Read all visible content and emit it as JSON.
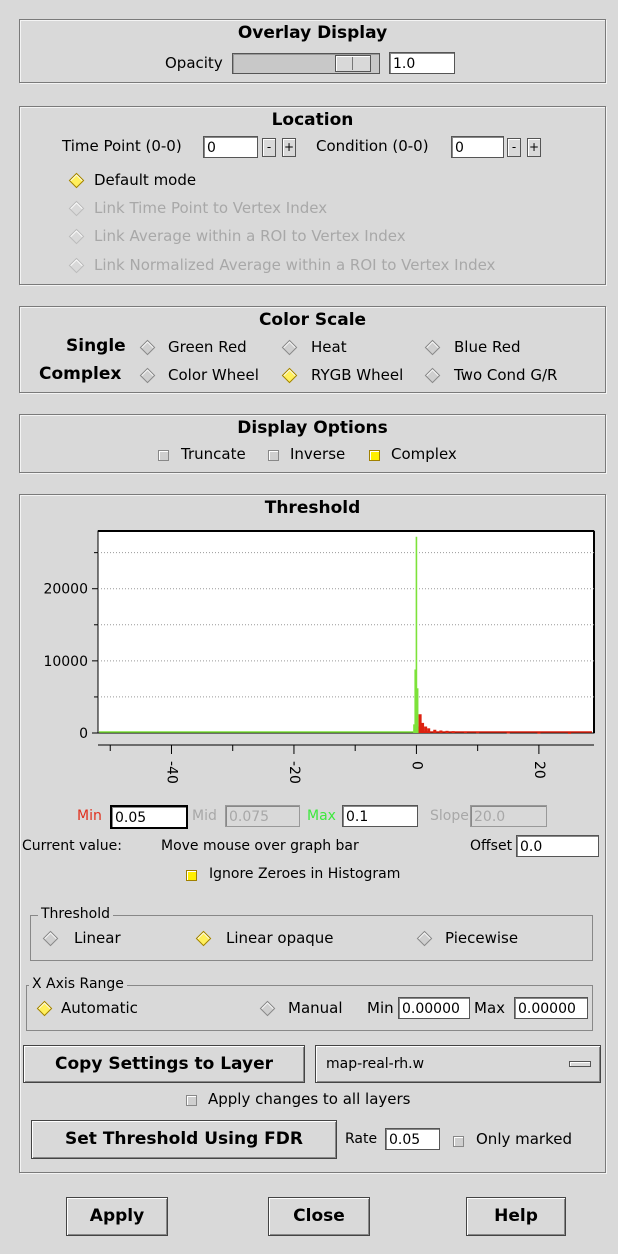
{
  "overlay": {
    "title": "Overlay Display",
    "opacity_label": "Opacity",
    "opacity_value": "1.0",
    "opacity_level": 1.0
  },
  "location": {
    "title": "Location",
    "time_point_label": "Time Point (0-0)",
    "time_point_value": "0",
    "condition_label": "Condition (0-0)",
    "condition_value": "0",
    "minus": "-",
    "plus": "+",
    "modes": [
      "Default mode",
      "Link Time Point to Vertex Index",
      "Link Average within a ROI to Vertex Index",
      "Link Normalized Average within a ROI to Vertex Index"
    ]
  },
  "color_scale": {
    "title": "Color Scale",
    "single_label": "Single",
    "complex_label": "Complex",
    "single_options": [
      "Green Red",
      "Heat",
      "Blue Red"
    ],
    "complex_options": [
      "Color Wheel",
      "RYGB Wheel",
      "Two Cond G/R"
    ]
  },
  "display_options": {
    "title": "Display Options",
    "truncate": "Truncate",
    "inverse": "Inverse",
    "complex": "Complex"
  },
  "threshold": {
    "title": "Threshold",
    "min_label": "Min",
    "min_value": "0.05",
    "mid_label": "Mid",
    "mid_value": "0.075",
    "max_label": "Max",
    "max_value": "0.1",
    "slope_label": "Slope",
    "slope_value": "20.0",
    "current_label": "Current value:",
    "current_text": "Move mouse over graph bar",
    "offset_label": "Offset",
    "offset_value": "0.0",
    "ignore_zeroes": "Ignore Zeroes in Histogram",
    "method_group": "Threshold",
    "methods": [
      "Linear",
      "Linear opaque",
      "Piecewise"
    ],
    "xrange_group": "X Axis Range",
    "automatic": "Automatic",
    "manual": "Manual",
    "manual_min_label": "Min",
    "manual_min_value": "0.00000",
    "manual_max_label": "Max",
    "manual_max_value": "0.00000",
    "copy_button": "Copy Settings to Layer",
    "layer_select": "map-real-rh.w",
    "apply_all": "Apply changes to all layers",
    "fdr_button": "Set Threshold Using FDR",
    "rate_label": "Rate",
    "rate_value": "0.05",
    "only_marked": "Only marked"
  },
  "chart_data": {
    "type": "bar",
    "ylim": [
      0,
      28000
    ],
    "xlim": [
      -52,
      29
    ],
    "yticks": [
      "0",
      "10000",
      "20000"
    ],
    "xticks": [
      "-40",
      "-20",
      "0",
      "20"
    ],
    "series": [
      {
        "color": "#7de23a",
        "x": [
          -0.4,
          -0.2,
          0.0,
          0.2,
          0.4
        ],
        "values": [
          1200,
          8800,
          27200,
          6200,
          900
        ]
      },
      {
        "color": "#dd2211",
        "x": [
          0.6,
          1,
          1.5,
          2,
          3,
          4,
          5,
          6,
          8,
          10,
          15,
          20,
          25
        ],
        "values": [
          2600,
          1400,
          900,
          650,
          450,
          350,
          300,
          250,
          180,
          120,
          80,
          40,
          20
        ]
      }
    ]
  },
  "footer": {
    "apply": "Apply",
    "close": "Close",
    "help": "Help"
  }
}
